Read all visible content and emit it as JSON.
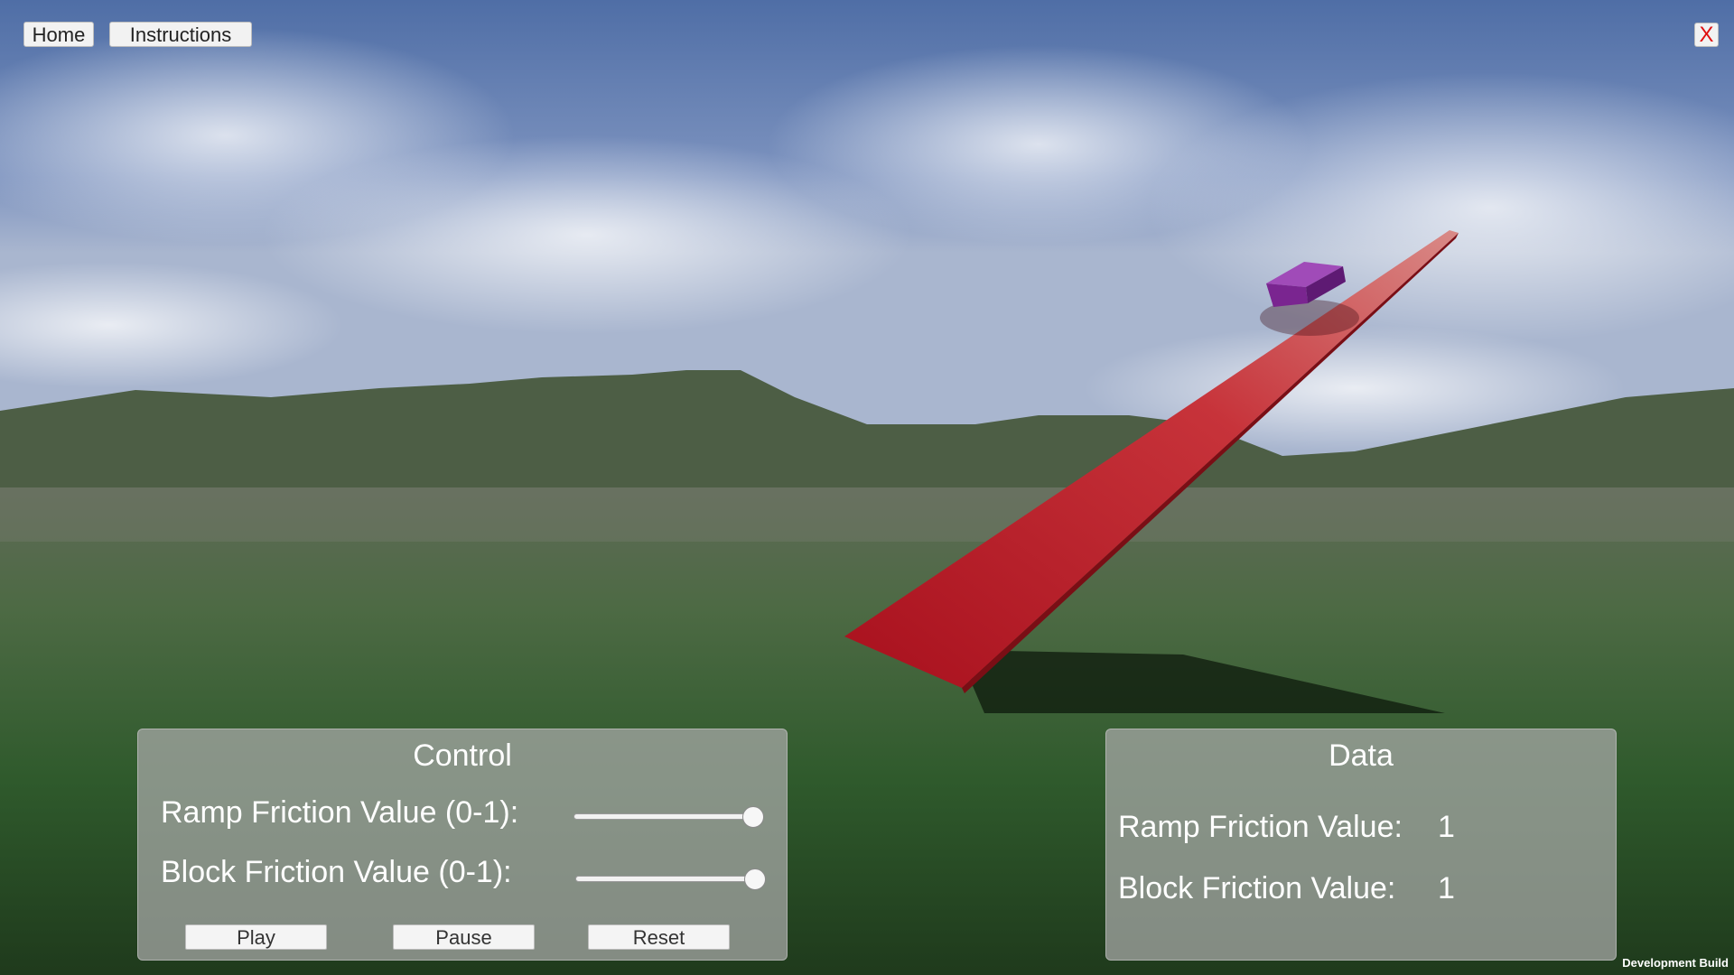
{
  "topbar": {
    "home_label": "Home",
    "instructions_label": "Instructions",
    "close_label": "X"
  },
  "control_panel": {
    "title": "Control",
    "ramp_label": "Ramp Friction Value (0-1):",
    "ramp_slider_value": 1,
    "block_label": "Block Friction Value (0-1):",
    "block_slider_value": 1,
    "play_label": "Play",
    "pause_label": "Pause",
    "reset_label": "Reset"
  },
  "data_panel": {
    "title": "Data",
    "ramp_label": "Ramp Friction Value:",
    "ramp_value": "1",
    "block_label": "Block Friction Value:",
    "block_value": "1"
  },
  "footer": {
    "build_label": "Development Build"
  },
  "colors": {
    "ramp": "#c4202b",
    "block": "#8a2aa0",
    "close_x": "#e01010"
  }
}
